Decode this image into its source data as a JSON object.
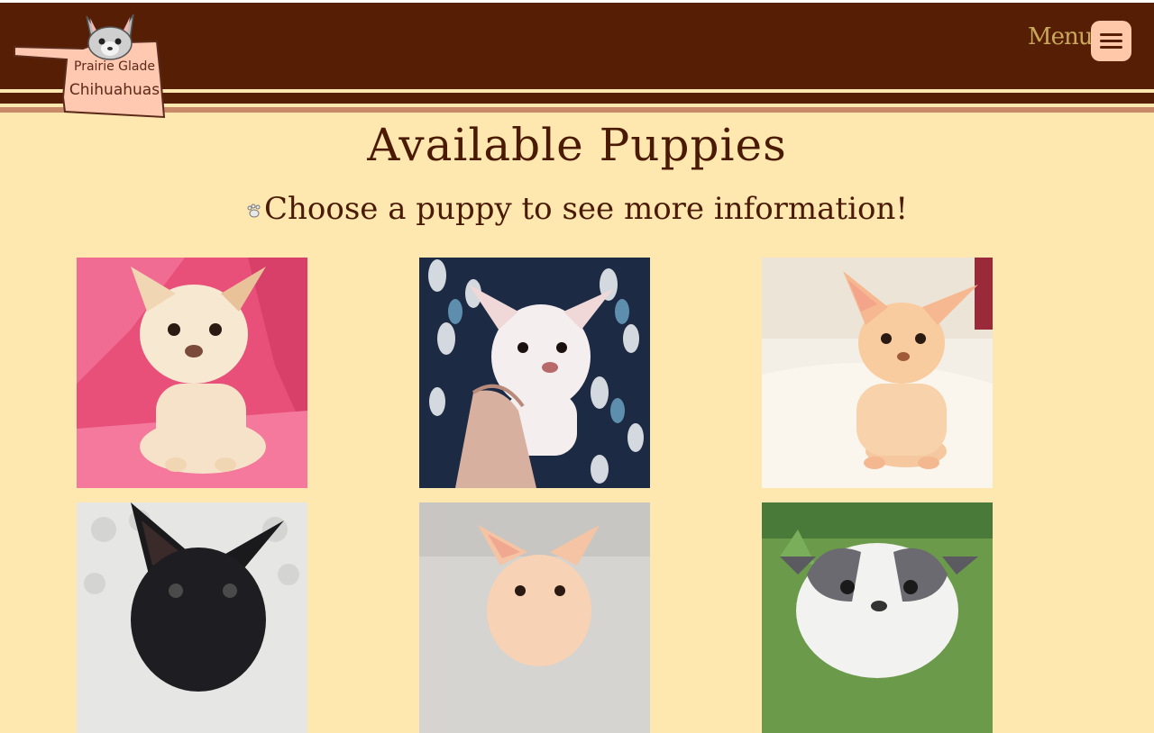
{
  "header": {
    "logo_line1": "Prairie Glade",
    "logo_line2": "Chihuahuas",
    "menu_label": "Menu"
  },
  "main": {
    "title": "Available Puppies",
    "subtitle": "Choose a puppy to see more information!"
  },
  "colors": {
    "header_brown": "#561e05",
    "page_background": "#ffe8b0",
    "menu_button": "#ffc8a8",
    "text_brown": "#4a1a05"
  },
  "icons": {
    "menu": "hamburger-icon",
    "bullet": "paw-icon"
  },
  "puppies": [
    {
      "background": "pink blanket",
      "coat": "cream"
    },
    {
      "background": "dark patterned blanket with hand",
      "coat": "white"
    },
    {
      "background": "cream blanket",
      "coat": "peach"
    },
    {
      "background": "white textured",
      "coat": "black"
    },
    {
      "background": "grey",
      "coat": "peach"
    },
    {
      "background": "green grass",
      "coat": "blue and white"
    }
  ]
}
